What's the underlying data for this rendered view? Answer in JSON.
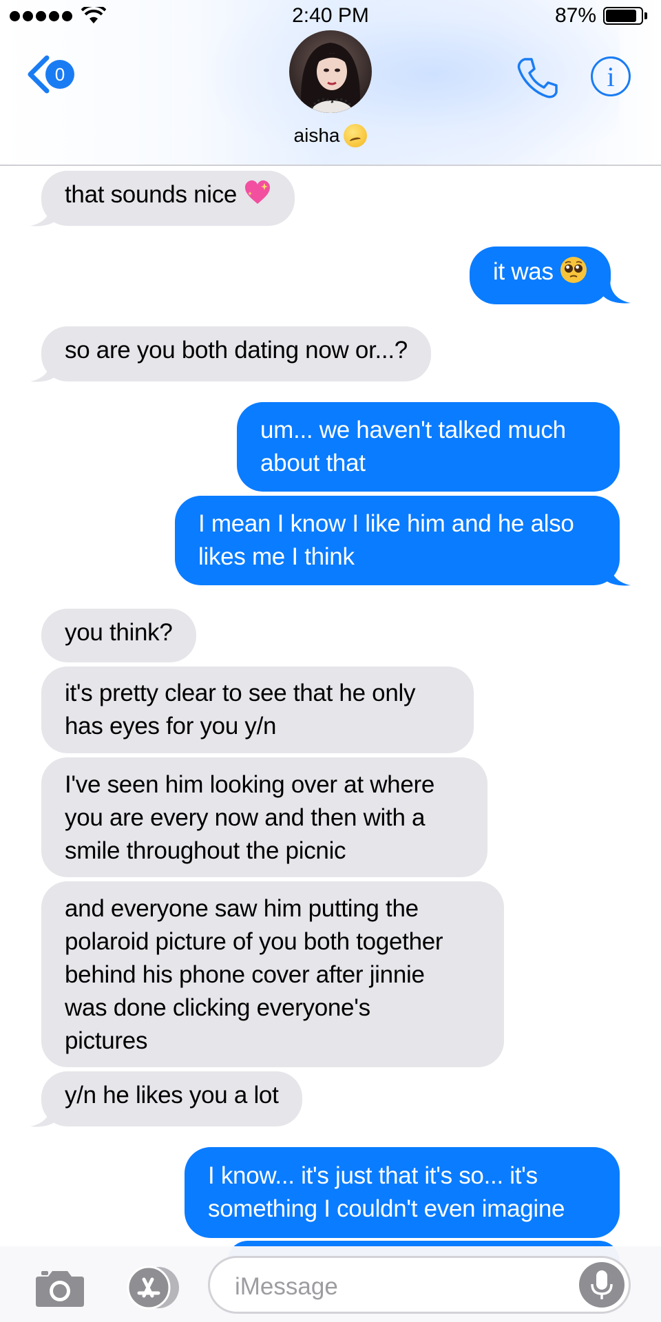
{
  "status_bar": {
    "time": "2:40 PM",
    "battery_percent": "87%",
    "battery_level": 0.87,
    "signal_bars": 5
  },
  "header": {
    "back_count": "0",
    "contact_name": "aisha"
  },
  "messages": [
    {
      "side": "incoming",
      "text": "that sounds nice",
      "emoji": "sparkling-heart"
    },
    {
      "side": "outgoing",
      "text": "it was",
      "emoji": "pleading-face"
    },
    {
      "side": "incoming",
      "text": "so are you both dating now or...?"
    },
    {
      "side": "outgoing",
      "lines": [
        "um... we haven't talked much",
        "about that"
      ]
    },
    {
      "side": "outgoing",
      "lines": [
        "I mean I know I like him and he also",
        "likes me I think"
      ]
    },
    {
      "side": "incoming",
      "text": "you think?"
    },
    {
      "side": "incoming",
      "lines": [
        "it's pretty clear to see that he only",
        "has eyes for you y/n"
      ]
    },
    {
      "side": "incoming",
      "lines": [
        "I've seen him looking over at where",
        "you are every now and then with a",
        "smile throughout the picnic"
      ]
    },
    {
      "side": "incoming",
      "lines": [
        "and everyone saw him putting the",
        "polaroid picture of you both together",
        "behind his phone cover after jinnie",
        "was done clicking everyone's",
        "pictures"
      ]
    },
    {
      "side": "incoming",
      "text": "y/n he likes you a lot"
    },
    {
      "side": "outgoing",
      "lines": [
        "I know... it's just that it's so... it's",
        "something I couldn't even imagine"
      ]
    }
  ],
  "input_bar": {
    "placeholder": "iMessage"
  },
  "colors": {
    "outgoing": "#0a7cff",
    "incoming": "#e5e5ea",
    "accent": "#1a7cf3"
  }
}
